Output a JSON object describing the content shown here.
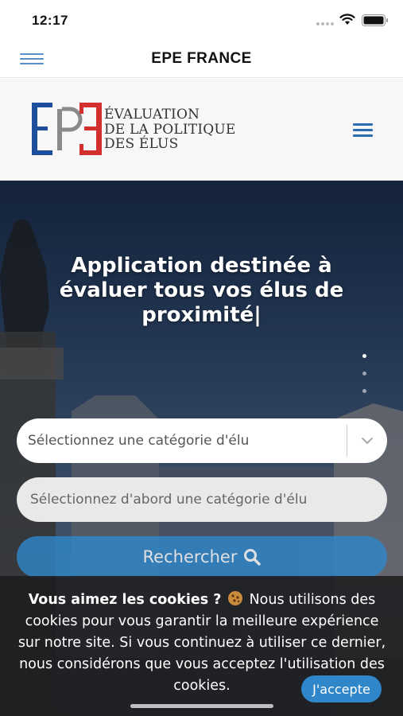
{
  "status_bar": {
    "time": "12:17",
    "icons": [
      "signal-dots-icon",
      "wifi-icon",
      "battery-icon"
    ]
  },
  "app_nav": {
    "title": "EPE FRANCE",
    "menu_icon": "hamburger-icon"
  },
  "site_header": {
    "logo_letters": "EPE",
    "logo_lines": [
      "ÉVALUATION",
      "DE LA POLITIQUE",
      "DES ÉLUS"
    ],
    "menu_icon": "hamburger-icon"
  },
  "hero": {
    "title_lines": [
      "Application destinée à",
      "évaluer tous vos élus de",
      "proximité|"
    ],
    "slider_dots": 3,
    "active_dot": 0
  },
  "search_form": {
    "category_select": {
      "value": "Sélectionnez une catégorie d'élu",
      "icon": "chevron-down-icon"
    },
    "subcategory_select": {
      "value": "Sélectionnez d'abord une catégorie d'élu"
    },
    "search_button": {
      "label": "Rechercher",
      "icon": "search-icon"
    }
  },
  "cookie_banner": {
    "heading": "Vous aimez les cookies ?",
    "icon": "cookie-icon",
    "body": " Nous utilisons des cookies pour vous garantir la meilleure expérience sur notre site. Si vous continuez à utiliser ce dernier, nous considérons que vous acceptez l'utilisation des cookies.",
    "accept_label": "J'accepte"
  },
  "colors": {
    "brand_blue": "#2f86c8",
    "flag_blue": "#1e4f9c",
    "flag_red": "#d32f2f",
    "header_menu": "#2a6cb0"
  }
}
